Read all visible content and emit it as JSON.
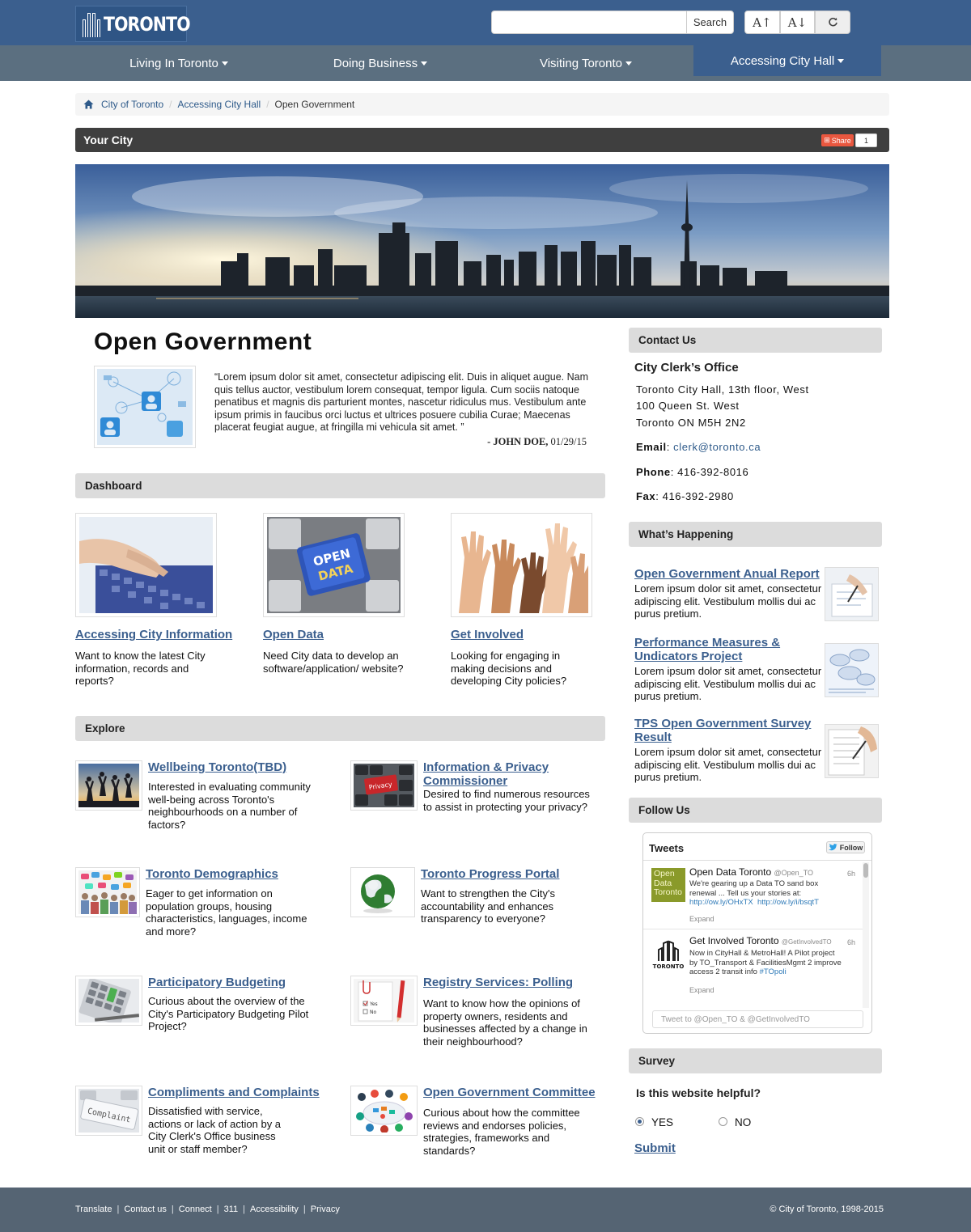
{
  "header": {
    "logo_text": "TORONTO",
    "search_placeholder": "",
    "search_button": "Search",
    "text_increase": "A↑",
    "text_decrease": "A↓",
    "reset_icon": "refresh-icon"
  },
  "nav": {
    "items": [
      {
        "label": "Living In Toronto"
      },
      {
        "label": "Doing Business"
      },
      {
        "label": "Visiting Toronto"
      },
      {
        "label": "Accessing City Hall",
        "active": true
      }
    ]
  },
  "breadcrumb": {
    "items": [
      "City of Toronto",
      "Accessing City Hall",
      "Open Government"
    ]
  },
  "section_bar": {
    "title": "Your City",
    "share_label": "Share",
    "share_count": "1"
  },
  "main": {
    "title": "Open Government",
    "quote": "“Lorem ipsum dolor sit amet, consectetur adipiscing elit. Duis in aliquet augue. Nam quis tellus auctor, vestibulum lorem consequat, tempor ligula. Cum sociis natoque penatibus et magnis dis parturient montes, nascetur ridiculus mus. Vestibulum ante ipsum primis in faucibus orci luctus et ultrices posuere cubilia Curae; Maecenas placerat feugiat augue, at fringilla mi vehicula sit amet. ”",
    "quote_author": "- JOHN DOE,",
    "quote_date": "01/29/15"
  },
  "dashboard": {
    "heading": "Dashboard",
    "cards": [
      {
        "title": "Accessing City Information",
        "desc": "Want to know the latest City information, records and reports?"
      },
      {
        "title": "Open Data",
        "desc": "Need City data to develop an software/application/ website?",
        "image_text_1": "OPEN",
        "image_text_2": "DATA"
      },
      {
        "title": "Get Involved",
        "desc": "Looking for engaging in making decisions and developing City policies?"
      }
    ]
  },
  "explore": {
    "heading": "Explore",
    "items": [
      {
        "title": "Wellbeing Toronto(TBD)",
        "desc": "Interested in evaluating community well-being across Toronto's neighbourhoods on a number of factors?"
      },
      {
        "title": "Information & Privacy Commissioner",
        "desc": "Desired to find numerous resources to assist in protecting your privacy?",
        "image_text": "Privacy"
      },
      {
        "title": "Toronto Demographics",
        "desc": "Eager to get information on population groups, housing characteristics, languages, income and more?"
      },
      {
        "title": "Toronto Progress Portal",
        "desc": "Want to strengthen the City's accountability and enhances transparency to everyone?"
      },
      {
        "title": "Participatory Budgeting",
        "desc": "Curious about the overview of the City's Participatory Budgeting Pilot Project?"
      },
      {
        "title": "Registry Services: Polling",
        "desc": "Want to know how the opinions of property owners, residents and businesses affected by a change in their neighbourhood?",
        "image_text_yes": "Yes",
        "image_text_no": "No"
      },
      {
        "title": "Compliments and Complaints",
        "desc": "Dissatisfied with service, actions or lack of action by a City Clerk's Office business unit or staff member?",
        "image_text": "Complaint"
      },
      {
        "title": "Open Government Committee",
        "desc": "Curious about how the committee reviews and endorses policies, strategies, frameworks and standards?"
      }
    ]
  },
  "contact": {
    "heading": "Contact Us",
    "office": "City Clerk’s Office",
    "address_1": "Toronto City Hall, 13th floor, West",
    "address_2": "100 Queen St. West",
    "address_3": "Toronto ON M5H 2N2",
    "email_label": "Email",
    "email": "clerk@toronto.ca",
    "phone_label": "Phone",
    "phone": "416-392-8016",
    "fax_label": "Fax",
    "fax": "416-392-2980"
  },
  "happening": {
    "heading": "What’s Happening",
    "items": [
      {
        "title": "Open Government Anual Report",
        "desc": "Lorem ipsum dolor sit amet, consectetur adipiscing elit. Vestibulum mollis dui ac purus pretium."
      },
      {
        "title": "Performance Measures & Undicators Project",
        "desc": "Lorem ipsum dolor sit amet, consectetur adipiscing elit. Vestibulum mollis dui ac purus pretium."
      },
      {
        "title": "TPS Open Government Survey Result",
        "desc": "Lorem ipsum dolor sit amet, consectetur adipiscing elit. Vestibulum mollis dui ac purus pretium."
      }
    ]
  },
  "follow": {
    "heading": "Follow Us",
    "widget_title": "Tweets",
    "follow_label": "Follow",
    "tweets": [
      {
        "avatar_text": "Open Data Toronto",
        "name": "Open Data Toronto",
        "handle": "@Open_TO",
        "time": "6h",
        "text": "We're gearing up a Data TO sand box renewal ... Tell us your stories at: ",
        "link_1": "http://ow.ly/OHxTX",
        "link_2": "http://ow.ly/i/bsqtT",
        "expand": "Expand"
      },
      {
        "avatar_text": "TORONTO",
        "name": "Get Involved Toronto",
        "handle": "@GetInvolvedTO",
        "time": "6h",
        "text": "Now in CityHall & MetroHall! A Pilot project by TO_Transport & FacilitiesMgmt 2 improve access 2 transit info ",
        "hashtag": "#TOpoli",
        "expand": "Expand"
      }
    ],
    "tweet_placeholder": "Tweet to @Open_TO & @GetInvolvedTO"
  },
  "survey": {
    "heading": "Survey",
    "question": "Is this website helpful?",
    "options": [
      {
        "label": "YES",
        "selected": true
      },
      {
        "label": "NO",
        "selected": false
      }
    ],
    "submit": "Submit"
  },
  "footer": {
    "links": [
      "Translate",
      "Contact us",
      "Connect",
      "311",
      "Accessibility",
      "Privacy"
    ],
    "copyright": "© City of Toronto, 1998-2015"
  },
  "colors": {
    "header_blue": "#3b5f8e",
    "nav_gray": "#5b6f80",
    "link_blue": "#3b5f8e",
    "footer_gray": "#556473",
    "share_red": "#e9573f"
  }
}
